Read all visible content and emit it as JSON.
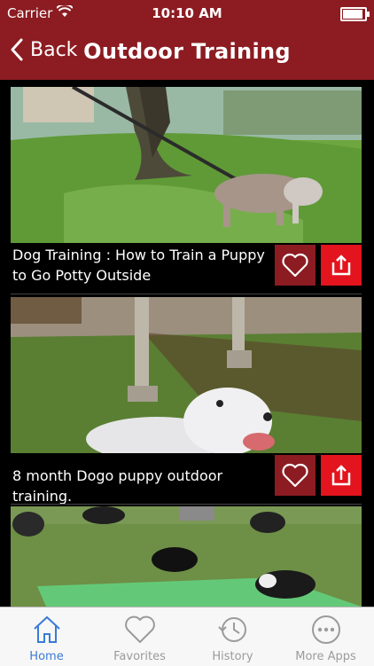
{
  "status": {
    "carrier": "Carrier",
    "time": "10:10 AM",
    "battery_level": 1.0
  },
  "nav": {
    "back_label": "Back",
    "title": "Outdoor Training"
  },
  "videos": [
    {
      "title": "Dog Training : How to Train a Puppy to Go Potty Outside"
    },
    {
      "title": "8 month Dogo puppy outdoor training."
    },
    {
      "title": ""
    }
  ],
  "tabs": [
    {
      "label": "Home",
      "icon": "home-icon",
      "active": true
    },
    {
      "label": "Favorites",
      "icon": "heart-icon",
      "active": false
    },
    {
      "label": "History",
      "icon": "history-icon",
      "active": false
    },
    {
      "label": "More Apps",
      "icon": "more-icon",
      "active": false
    }
  ],
  "colors": {
    "brand": "#8c1c22",
    "share": "#e3141e",
    "active_tab": "#3a7bd5",
    "inactive_tab": "#9b9b9b"
  }
}
